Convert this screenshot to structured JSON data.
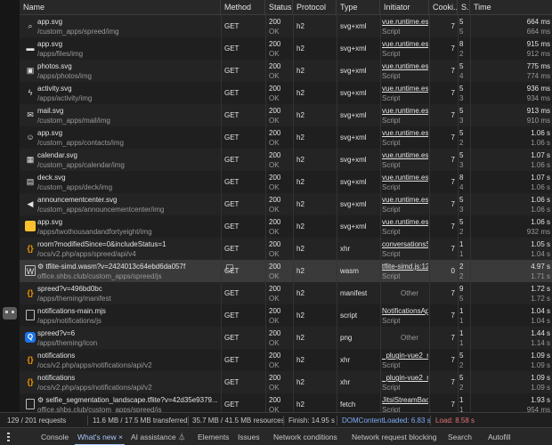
{
  "columns": [
    {
      "key": "name",
      "label": "Name"
    },
    {
      "key": "method",
      "label": "Method"
    },
    {
      "key": "status",
      "label": "Status"
    },
    {
      "key": "protocol",
      "label": "Protocol"
    },
    {
      "key": "type",
      "label": "Type"
    },
    {
      "key": "initiator",
      "label": "Initiator"
    },
    {
      "key": "cookies",
      "label": "Cooki..."
    },
    {
      "key": "size",
      "label": "S..."
    },
    {
      "key": "time",
      "label": "Time"
    }
  ],
  "rows": [
    {
      "icon": "search-icon",
      "name": "app.svg",
      "path": "/custom_apps/spreed/img",
      "method": "GET",
      "status": "200",
      "status_text": "OK",
      "protocol": "h2",
      "type": "svg+xml",
      "initiator": "vue.runtime.esm",
      "initiator_sub": "Script",
      "cookies": "7",
      "size": "5",
      "size_sub": "5",
      "time": "664 ms",
      "time_sub": "664 ms"
    },
    {
      "icon": "folder-icon",
      "name": "app.svg",
      "path": "/apps/files/img",
      "method": "GET",
      "status": "200",
      "status_text": "OK",
      "protocol": "h2",
      "type": "svg+xml",
      "initiator": "vue.runtime.esm",
      "initiator_sub": "Script",
      "cookies": "7",
      "size": "8",
      "size_sub": "2",
      "time": "915 ms",
      "time_sub": "912 ms"
    },
    {
      "icon": "image-icon",
      "name": "photos.svg",
      "path": "/apps/photos/img",
      "method": "GET",
      "status": "200",
      "status_text": "OK",
      "protocol": "h2",
      "type": "svg+xml",
      "initiator": "vue.runtime.esm",
      "initiator_sub": "Script",
      "cookies": "7",
      "size": "5",
      "size_sub": "4",
      "time": "775 ms",
      "time_sub": "774 ms"
    },
    {
      "icon": "lightning-icon",
      "name": "activity.svg",
      "path": "/apps/activity/img",
      "method": "GET",
      "status": "200",
      "status_text": "OK",
      "protocol": "h2",
      "type": "svg+xml",
      "initiator": "vue.runtime.esm",
      "initiator_sub": "Script",
      "cookies": "7",
      "size": "5",
      "size_sub": "3",
      "time": "936 ms",
      "time_sub": "934 ms"
    },
    {
      "icon": "mail-icon",
      "name": "mail.svg",
      "path": "/custom_apps/mail/img",
      "method": "GET",
      "status": "200",
      "status_text": "OK",
      "protocol": "h2",
      "type": "svg+xml",
      "initiator": "vue.runtime.esm",
      "initiator_sub": "Script",
      "cookies": "7",
      "size": "5",
      "size_sub": "3",
      "time": "913 ms",
      "time_sub": "910 ms"
    },
    {
      "icon": "contacts-icon",
      "name": "app.svg",
      "path": "/custom_apps/contacts/img",
      "method": "GET",
      "status": "200",
      "status_text": "OK",
      "protocol": "h2",
      "type": "svg+xml",
      "initiator": "vue.runtime.esm",
      "initiator_sub": "Script",
      "cookies": "7",
      "size": "5",
      "size_sub": "2",
      "time": "1.06 s",
      "time_sub": "1.06 s"
    },
    {
      "icon": "calendar-icon",
      "name": "calendar.svg",
      "path": "/custom_apps/calendar/img",
      "method": "GET",
      "status": "200",
      "status_text": "OK",
      "protocol": "h2",
      "type": "svg+xml",
      "initiator": "vue.runtime.esm",
      "initiator_sub": "Script",
      "cookies": "7",
      "size": "5",
      "size_sub": "3",
      "time": "1.07 s",
      "time_sub": "1.06 s"
    },
    {
      "icon": "deck-icon",
      "name": "deck.svg",
      "path": "/custom_apps/deck/img",
      "method": "GET",
      "status": "200",
      "status_text": "OK",
      "protocol": "h2",
      "type": "svg+xml",
      "initiator": "vue.runtime.esm",
      "initiator_sub": "Script",
      "cookies": "7",
      "size": "8",
      "size_sub": "4",
      "time": "1.07 s",
      "time_sub": "1.06 s"
    },
    {
      "icon": "megaphone-icon",
      "name": "announcementcenter.svg",
      "path": "/custom_apps/announcementcenter/img",
      "method": "GET",
      "status": "200",
      "status_text": "OK",
      "protocol": "h2",
      "type": "svg+xml",
      "initiator": "vue.runtime.esm",
      "initiator_sub": "Script",
      "cookies": "7",
      "size": "5",
      "size_sub": "3",
      "time": "1.06 s",
      "time_sub": "1.06 s"
    },
    {
      "icon": "app-tile-icon",
      "name": "app.svg",
      "path": "/apps/twothousandandfortyeight/img",
      "method": "GET",
      "status": "200",
      "status_text": "OK",
      "protocol": "h2",
      "type": "svg+xml",
      "initiator": "vue.runtime.esm",
      "initiator_sub": "Script",
      "cookies": "7",
      "size": "5",
      "size_sub": "2",
      "time": "1.06 s",
      "time_sub": "932 ms"
    },
    {
      "icon": "json-icon",
      "name": "room?modifiedSince=0&includeStatus=1",
      "path": "/ocs/v2.php/apps/spreed/api/v4",
      "method": "GET",
      "status": "200",
      "status_text": "OK",
      "protocol": "h2",
      "type": "xhr",
      "initiator": "conversationsS",
      "initiator_sub": "Script",
      "cookies": "7",
      "size": "1",
      "size_sub": "1",
      "time": "1.05 s",
      "time_sub": "1.04 s"
    },
    {
      "icon": "wasm-icon",
      "name": "⚙ tflite-simd.wasm?v=2424013c64ebd6da057f",
      "path": "office.shbs.club/custom_apps/spreed/js",
      "method": "GET",
      "status": "200",
      "status_text": "OK",
      "protocol": "h2",
      "type": "wasm",
      "initiator": "tflite-simd.js:12",
      "initiator_sub": "Script",
      "cookies": "0",
      "size": "2",
      "size_sub": "2",
      "time": "4.97 s",
      "time_sub": "1.71 s",
      "selected": true
    },
    {
      "icon": "json-icon",
      "name": "spreed?v=496bd0bc",
      "path": "/apps/theming/manifest",
      "method": "GET",
      "status": "200",
      "status_text": "OK",
      "protocol": "h2",
      "type": "manifest",
      "initiator": "Other",
      "initiator_sub": "",
      "cookies": "7",
      "size": "9",
      "size_sub": "5",
      "time": "1.72 s",
      "time_sub": "1.72 s"
    },
    {
      "icon": "file-icon",
      "name": "notifications-main.mjs",
      "path": "/apps/notifications/js",
      "method": "GET",
      "status": "200",
      "status_text": "OK",
      "protocol": "h2",
      "type": "script",
      "initiator": "NotificationsAp",
      "initiator_sub": "Script",
      "cookies": "7",
      "size": "1",
      "size_sub": "1",
      "time": "1.04 s",
      "time_sub": "1.04 s"
    },
    {
      "icon": "q-app-icon",
      "name": "spreed?v=6",
      "path": "/apps/theming/icon",
      "method": "GET",
      "status": "200",
      "status_text": "OK",
      "protocol": "h2",
      "type": "png",
      "initiator": "Other",
      "initiator_sub": "",
      "cookies": "7",
      "size": "1",
      "size_sub": "1",
      "time": "1.44 s",
      "time_sub": "1.14 s"
    },
    {
      "icon": "json-icon",
      "name": "notifications",
      "path": "/ocs/v2.php/apps/notifications/api/v2",
      "method": "GET",
      "status": "200",
      "status_text": "OK",
      "protocol": "h2",
      "type": "xhr",
      "initiator": "_plugin-vue2_n",
      "initiator_sub": "Script",
      "cookies": "7",
      "size": "5",
      "size_sub": "2",
      "time": "1.09 s",
      "time_sub": "1.09 s"
    },
    {
      "icon": "json-icon",
      "name": "notifications",
      "path": "/ocs/v2.php/apps/notifications/api/v2",
      "method": "GET",
      "status": "200",
      "status_text": "OK",
      "protocol": "h2",
      "type": "xhr",
      "initiator": "_plugin-vue2_n",
      "initiator_sub": "Script",
      "cookies": "7",
      "size": "5",
      "size_sub": "2",
      "time": "1.09 s",
      "time_sub": "1.09 s"
    },
    {
      "icon": "file-icon",
      "name": "⚙ selfie_segmentation_landscape.tflite?v=42d35e9379...",
      "path": "office.shbs.club/custom_apps/spreed/js",
      "method": "GET",
      "status": "200",
      "status_text": "OK",
      "protocol": "h2",
      "type": "fetch",
      "initiator": "JitsiStreamBacl",
      "initiator_sub": "Script",
      "cookies": "7",
      "size": "1",
      "size_sub": "1",
      "time": "1.93 s",
      "time_sub": "954 ms"
    }
  ],
  "status_bar": {
    "requests": "129 / 201 requests",
    "transferred": "11.6 MB / 17.5 MB transferred",
    "resources": "35.7 MB / 41.5 MB resources",
    "finish": "Finish: 14.95 s",
    "dom_content_loaded": "DOMContentLoaded: 6.83 s",
    "load": "Load: 8.58 s"
  },
  "drawer": {
    "tabs": [
      {
        "label": "Console"
      },
      {
        "label": "What's new ×",
        "active": true
      },
      {
        "label": "AI assistance ⏃"
      },
      {
        "label": "Elements"
      },
      {
        "label": "Issues"
      },
      {
        "label": "Network conditions"
      },
      {
        "label": "Network request blocking"
      },
      {
        "label": "Search"
      },
      {
        "label": "Autofill"
      }
    ]
  },
  "colors": {
    "dcl": "#7cacf8",
    "load": "#e57373",
    "accent": "#a8c7fa"
  }
}
